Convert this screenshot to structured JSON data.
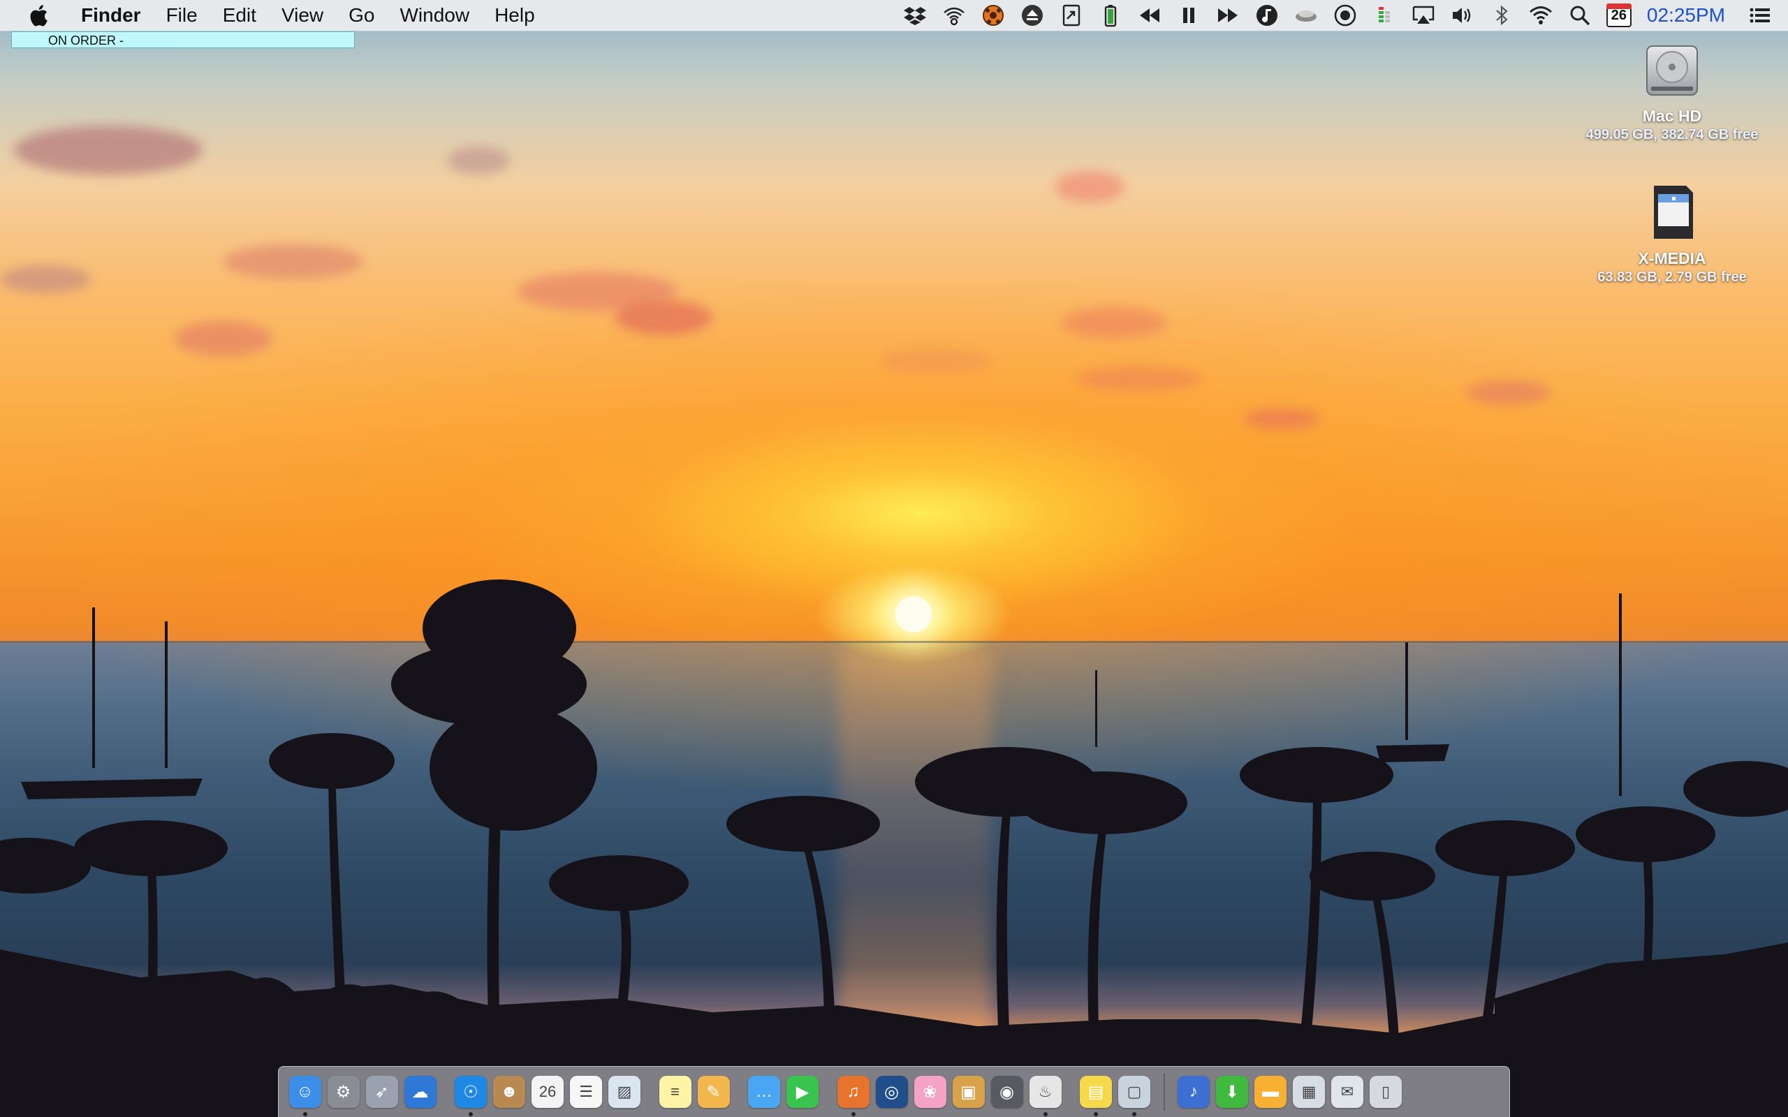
{
  "menubar": {
    "app_name": "Finder",
    "menus": [
      "File",
      "Edit",
      "View",
      "Go",
      "Window",
      "Help"
    ],
    "status_icons": [
      "dropbox-icon",
      "wireless-signal-icon",
      "soccer-ball-icon",
      "eject-icon",
      "document-arrow-icon",
      "battery-icon",
      "rewind-icon",
      "pause-icon",
      "fast-forward-icon",
      "music-note-icon",
      "teacup-icon",
      "record-icon",
      "level-meter-icon",
      "airplay-icon",
      "volume-icon",
      "bluetooth-icon",
      "wifi-icon",
      "spotlight-search-icon"
    ],
    "calendar_day": "26",
    "clock": "02:25PM",
    "clock_color": "#1d4fcf"
  },
  "on_order_note": "ON ORDER -",
  "desktop_icons": [
    {
      "name": "Mac HD",
      "info": "499.05 GB, 382.74 GB free",
      "icon": "hard-drive-icon"
    },
    {
      "name": "X-MEDIA",
      "info": "63.83 GB, 2.79 GB free",
      "icon": "sd-card-icon"
    }
  ],
  "dock": {
    "apps": [
      {
        "name": "Finder",
        "icon": "finder-icon",
        "color": "#3d8ee8",
        "running": true
      },
      {
        "name": "System Preferences",
        "icon": "gear-icon",
        "color": "#8a8d93",
        "running": false
      },
      {
        "name": "Launchpad",
        "icon": "rocket-icon",
        "color": "#9aa2b2",
        "running": false
      },
      {
        "name": "iCloud Drive",
        "icon": "cloud-icon",
        "color": "#2e78d8",
        "running": false
      },
      {
        "name": "Safari",
        "icon": "compass-icon",
        "color": "#1e88e5",
        "running": true
      },
      {
        "name": "Contacts",
        "icon": "contacts-icon",
        "color": "#b88a52",
        "running": false
      },
      {
        "name": "Calendar",
        "icon": "calendar-icon",
        "color": "#f4f4f4",
        "running": false
      },
      {
        "name": "Reminders",
        "icon": "reminders-icon",
        "color": "#f7f7f7",
        "running": false
      },
      {
        "name": "Preview",
        "icon": "preview-icon",
        "color": "#d9e6f2",
        "running": false
      },
      {
        "name": "Notes",
        "icon": "notes-icon",
        "color": "#fff3a6",
        "running": false
      },
      {
        "name": "TextEdit",
        "icon": "pencil-icon",
        "color": "#f2b64c",
        "running": false
      },
      {
        "name": "Messages",
        "icon": "chat-bubble-icon",
        "color": "#49a6f2",
        "running": false
      },
      {
        "name": "FaceTime",
        "icon": "video-camera-icon",
        "color": "#39c44f",
        "running": false
      },
      {
        "name": "iTunes",
        "icon": "music-disc-icon",
        "color": "#e8732c",
        "running": true
      },
      {
        "name": "Network Utility",
        "icon": "globe-icon",
        "color": "#1f4e8a",
        "running": false
      },
      {
        "name": "Photos",
        "icon": "pinwheel-icon",
        "color": "#f4a3c4",
        "running": false
      },
      {
        "name": "Image Capture",
        "icon": "photo-stack-icon",
        "color": "#d8a24a",
        "running": false
      },
      {
        "name": "Disk Utility",
        "icon": "disk-icon",
        "color": "#585a61",
        "running": false
      },
      {
        "name": "Popcorn App",
        "icon": "popcorn-icon",
        "color": "#e6e6e6",
        "running": true
      },
      {
        "name": "Stickies",
        "icon": "sticky-note-icon",
        "color": "#f6d84b",
        "running": true
      },
      {
        "name": "Screenshot Tool",
        "icon": "screenshot-icon",
        "color": "#c9d3de",
        "running": true
      },
      {
        "name": "Music Notation",
        "icon": "treble-clef-icon",
        "color": "#3c6fd1",
        "running": false
      },
      {
        "name": "Downloads",
        "icon": "download-arrow-icon",
        "color": "#3fba3f",
        "running": false
      },
      {
        "name": "Documents Folder",
        "icon": "folder-icon",
        "color": "#f7b032",
        "running": false
      },
      {
        "name": "Screenshots Folder",
        "icon": "image-folder-icon",
        "color": "#d7dde4",
        "running": false
      },
      {
        "name": "Mail Folder",
        "icon": "envelope-folder-icon",
        "color": "#dfe5ea",
        "running": false
      },
      {
        "name": "Trash",
        "icon": "trash-icon",
        "color": "#d6d9dd",
        "running": false
      }
    ]
  }
}
